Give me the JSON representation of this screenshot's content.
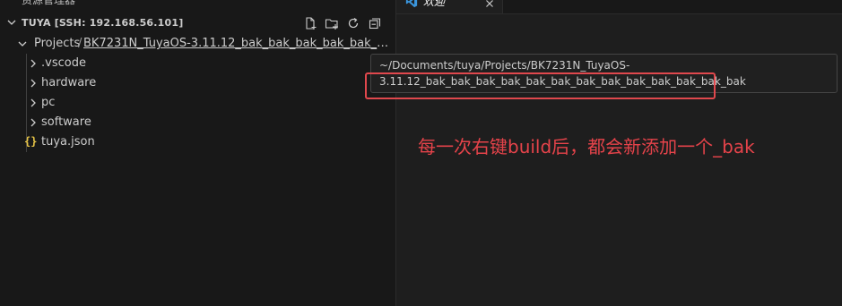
{
  "sidebar": {
    "title": "资源管理器",
    "section_title": "TUYA [SSH: 192.168.56.101]",
    "toolbar_icons": [
      "new-file-icon",
      "new-folder-icon",
      "refresh-icon",
      "collapse-all-icon"
    ],
    "breadcrumb": {
      "part1": "Projects",
      "separator": "/",
      "part2": "BK7231N_TuyaOS-3.11.12_bak_bak_bak_bak_bak_bak_bak_bak_bak_bak_bak_bak"
    },
    "items": [
      {
        "label": ".vscode",
        "type": "folder"
      },
      {
        "label": "hardware",
        "type": "folder"
      },
      {
        "label": "pc",
        "type": "folder"
      },
      {
        "label": "software",
        "type": "folder"
      },
      {
        "label": "tuya.json",
        "type": "file",
        "icon": "{}"
      }
    ]
  },
  "tab": {
    "label": "欢迎",
    "icon": "vscode-icon"
  },
  "tooltip": {
    "line1": "~/Documents/tuya/Projects/BK7231N_TuyaOS-",
    "line2": "3.11.12_bak_bak_bak_bak_bak_bak_bak_bak_bak_bak_bak_bak_bak"
  },
  "annotation": "每一次右键build后，都会新添加一个_bak",
  "colors": {
    "annotation": "#e5434a",
    "highlight_box": "#e0484d",
    "json_icon": "#e8c547",
    "vscode_blue": "#3a96dd"
  }
}
